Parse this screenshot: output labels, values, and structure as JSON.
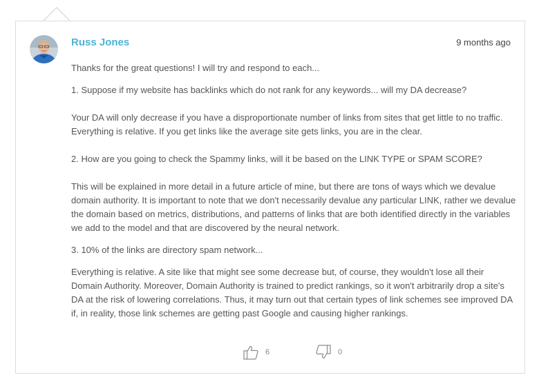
{
  "comment": {
    "author": "Russ Jones",
    "timestamp": "9 months ago",
    "avatar_icon": "user-avatar",
    "paragraphs": [
      "Thanks for the great questions! I will try and respond to each...",
      "1. Suppose if my website has backlinks which do not rank for any keywords... will my DA decrease?",
      "Your DA will only decrease if you have a disproportionate number of links from sites that get little to no traffic. Everything is relative. If you get links like the average site gets links, you are in the clear.",
      "2. How are you going to check the Spammy links, will it be based on the LINK TYPE or SPAM SCORE?",
      "This will be explained in more detail in a future article of mine, but there are tons of ways which we devalue domain authority. It is important to note that we don't necessarily devalue any particular LINK, rather we devalue the domain based on metrics, distributions, and patterns of links that are both identified directly in the variables we add to the model and that are discovered by the neural network.",
      "3. 10% of the links are directory spam network...",
      "Everything is relative. A site like that might see some decrease but, of course, they wouldn't lose all their Domain Authority. Moreover, Domain Authority is trained to predict rankings, so it won't arbitrarily drop a site's DA at the risk of lowering correlations. Thus, it may turn out that certain types of link schemes see improved DA if, in reality, those link schemes are getting past Google and causing higher rankings."
    ],
    "votes": {
      "up_icon": "thumbs-up-icon",
      "up_count": "6",
      "down_icon": "thumbs-down-icon",
      "down_count": "0"
    }
  },
  "colors": {
    "author_link": "#4ab3d8",
    "body_text": "#555555",
    "border": "#dcdcdc"
  }
}
